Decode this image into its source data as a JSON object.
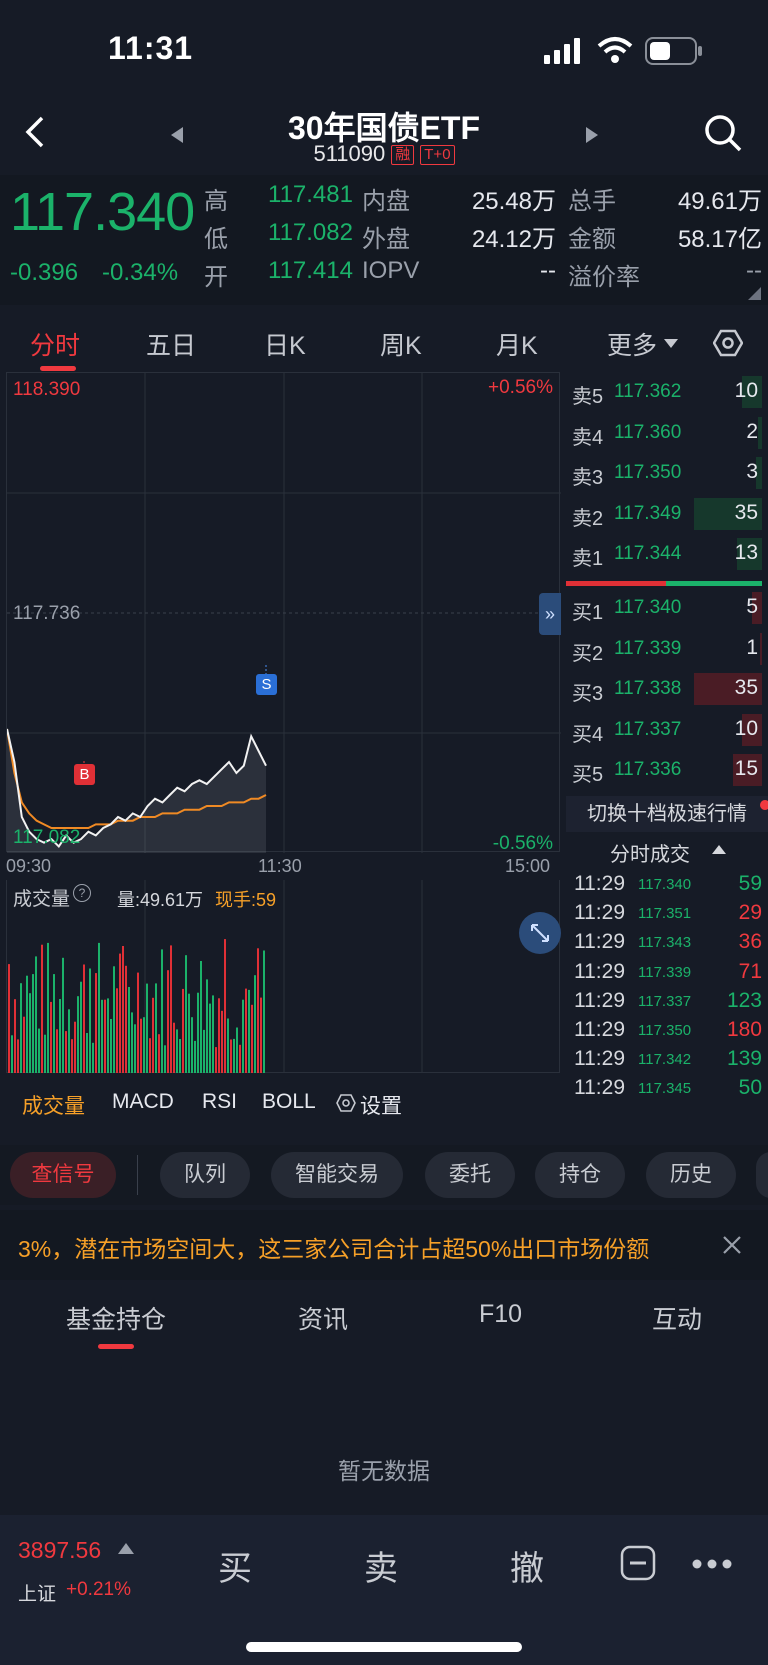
{
  "status": {
    "time": "11:31"
  },
  "header": {
    "title": "30年国债ETF",
    "code": "511090",
    "tag1": "融",
    "tag2": "T+0"
  },
  "quote": {
    "price": "117.340",
    "change": "-0.396",
    "change_pct": "-0.34%",
    "high_label": "高",
    "high": "117.481",
    "low_label": "低",
    "low": "117.082",
    "open_label": "开",
    "open": "117.414",
    "inner_label": "内盘",
    "inner": "25.48万",
    "outer_label": "外盘",
    "outer": "24.12万",
    "iopv_label": "IOPV",
    "iopv": "--",
    "total_label": "总手",
    "total": "49.61万",
    "amount_label": "金额",
    "amount": "58.17亿",
    "premium_label": "溢价率",
    "premium": "--"
  },
  "tabs": [
    "分时",
    "五日",
    "日K",
    "周K",
    "月K",
    "更多"
  ],
  "chart": {
    "top_price": "118.390",
    "mid_price": "117.736",
    "bottom_price": "117.082",
    "top_pct": "+0.56%",
    "bottom_pct": "-0.56%",
    "time_start": "09:30",
    "time_mid": "11:30",
    "time_end": "15:00",
    "marker_b": "B",
    "marker_s": "S"
  },
  "chart_data": {
    "type": "line",
    "title": "",
    "x_range": [
      "09:30",
      "15:00"
    ],
    "ylim": [
      117.082,
      118.39
    ],
    "reference": 117.736,
    "series": [
      {
        "values": [
          117.42,
          117.33,
          117.18,
          117.14,
          117.12,
          117.11,
          117.12,
          117.1,
          117.13,
          117.11,
          117.12,
          117.14,
          117.13,
          117.15,
          117.16,
          117.18,
          117.17,
          117.19,
          117.18,
          117.21,
          117.23,
          117.22,
          117.24,
          117.26,
          117.25,
          117.27,
          117.28,
          117.27,
          117.29,
          117.31,
          117.33,
          117.3,
          117.32,
          117.4,
          117.36,
          117.32
        ]
      },
      {
        "values": [
          117.42,
          117.3,
          117.22,
          117.19,
          117.17,
          117.16,
          117.15,
          117.15,
          117.15,
          117.15,
          117.15,
          117.15,
          117.16,
          117.16,
          117.16,
          117.17,
          117.17,
          117.17,
          117.18,
          117.18,
          117.18,
          117.19,
          117.19,
          117.19,
          117.2,
          117.2,
          117.2,
          117.21,
          117.21,
          117.21,
          117.22,
          117.22,
          117.22,
          117.23,
          117.23,
          117.24
        ]
      }
    ]
  },
  "volume": {
    "label": "成交量",
    "total": "量:49.61万",
    "current": "现手:59"
  },
  "order_book": {
    "asks": [
      {
        "label": "卖5",
        "price": "117.362",
        "qty": "10",
        "bar": 0.29
      },
      {
        "label": "卖4",
        "price": "117.360",
        "qty": "2",
        "bar": 0.06
      },
      {
        "label": "卖3",
        "price": "117.350",
        "qty": "3",
        "bar": 0.09
      },
      {
        "label": "卖2",
        "price": "117.349",
        "qty": "35",
        "bar": 1.0
      },
      {
        "label": "卖1",
        "price": "117.344",
        "qty": "13",
        "bar": 0.37
      }
    ],
    "bids": [
      {
        "label": "买1",
        "price": "117.340",
        "qty": "5",
        "bar": 0.14
      },
      {
        "label": "买2",
        "price": "117.339",
        "qty": "1",
        "bar": 0.03
      },
      {
        "label": "买3",
        "price": "117.338",
        "qty": "35",
        "bar": 1.0
      },
      {
        "label": "买4",
        "price": "117.337",
        "qty": "10",
        "bar": 0.29
      },
      {
        "label": "买5",
        "price": "117.336",
        "qty": "15",
        "bar": 0.43
      }
    ],
    "switch_label": "切换十档极速行情",
    "trades_label": "分时成交"
  },
  "trades": [
    {
      "time": "11:29",
      "price": "117.340",
      "qty": "59",
      "side": "buy"
    },
    {
      "time": "11:29",
      "price": "117.351",
      "qty": "29",
      "side": "sell"
    },
    {
      "time": "11:29",
      "price": "117.343",
      "qty": "36",
      "side": "sell"
    },
    {
      "time": "11:29",
      "price": "117.339",
      "qty": "71",
      "side": "sell"
    },
    {
      "time": "11:29",
      "price": "117.337",
      "qty": "123",
      "side": "buy"
    },
    {
      "time": "11:29",
      "price": "117.350",
      "qty": "180",
      "side": "sell"
    },
    {
      "time": "11:29",
      "price": "117.342",
      "qty": "139",
      "side": "buy"
    },
    {
      "time": "11:29",
      "price": "117.345",
      "qty": "50",
      "side": "buy"
    }
  ],
  "indicators": [
    "成交量",
    "MACD",
    "RSI",
    "BOLL",
    "设置"
  ],
  "action_buttons": [
    "查信号",
    "队列",
    "智能交易",
    "委托",
    "持仓",
    "历史"
  ],
  "news": "3%，潜在市场空间大，这三家公司合计占超50%出口市场份额",
  "bottom_tabs": [
    "基金持仓",
    "资讯",
    "F10",
    "互动"
  ],
  "empty_text": "暂无数据",
  "index": {
    "value": "3897.56",
    "name": "上证",
    "pct": "+0.21%"
  },
  "trade": {
    "buy": "买",
    "sell": "卖",
    "cancel": "撤"
  }
}
